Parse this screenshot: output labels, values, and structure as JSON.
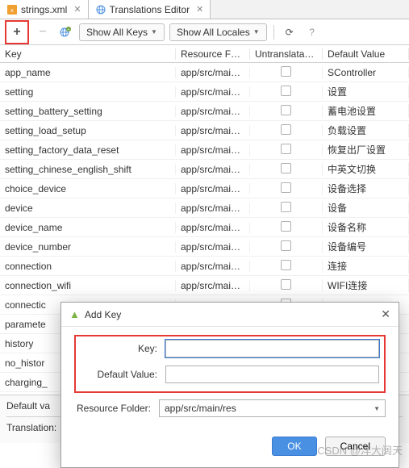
{
  "tabs": [
    {
      "label": "strings.xml",
      "icon": "xml"
    },
    {
      "label": "Translations Editor",
      "icon": "globe"
    }
  ],
  "toolbar": {
    "keys_dropdown": "Show All Keys",
    "locales_dropdown": "Show All Locales"
  },
  "columns": {
    "key": "Key",
    "res": "Resource Folder",
    "un": "Untranslatable",
    "def": "Default Value"
  },
  "rows": [
    {
      "key": "app_name",
      "res": "app/src/main/res",
      "def": "SController"
    },
    {
      "key": "setting",
      "res": "app/src/main/res",
      "def": "设置"
    },
    {
      "key": "setting_battery_setting",
      "res": "app/src/main/res",
      "def": "蓄电池设置"
    },
    {
      "key": "setting_load_setup",
      "res": "app/src/main/res",
      "def": "负载设置"
    },
    {
      "key": "setting_factory_data_reset",
      "res": "app/src/main/res",
      "def": "恢复出厂设置"
    },
    {
      "key": "setting_chinese_english_shift",
      "res": "app/src/main/res",
      "def": "中英文切换"
    },
    {
      "key": "choice_device",
      "res": "app/src/main/res",
      "def": "设备选择"
    },
    {
      "key": "device",
      "res": "app/src/main/res",
      "def": "设备"
    },
    {
      "key": "device_name",
      "res": "app/src/main/res",
      "def": "设备名称"
    },
    {
      "key": "device_number",
      "res": "app/src/main/res",
      "def": "设备编号"
    },
    {
      "key": "connection",
      "res": "app/src/main/res",
      "def": "连接"
    },
    {
      "key": "connection_wifi",
      "res": "app/src/main/res",
      "def": "WIFI连接"
    },
    {
      "key": "connectic",
      "res": "",
      "def": ""
    },
    {
      "key": "paramete",
      "res": "",
      "def": ""
    },
    {
      "key": "history",
      "res": "",
      "def": ""
    },
    {
      "key": "no_histor",
      "res": "",
      "def": ""
    },
    {
      "key": "charging_",
      "res": "",
      "def": ""
    }
  ],
  "bottom": {
    "default_label": "Default va",
    "translation_label": "Translation:"
  },
  "dialog": {
    "title": "Add Key",
    "key_label": "Key:",
    "key_value": "",
    "default_label": "Default Value:",
    "default_value": "",
    "folder_label": "Resource Folder:",
    "folder_value": "app/src/main/res",
    "ok": "OK",
    "cancel": "Cancel"
  },
  "watermark": "CSDN @洋大阔天"
}
